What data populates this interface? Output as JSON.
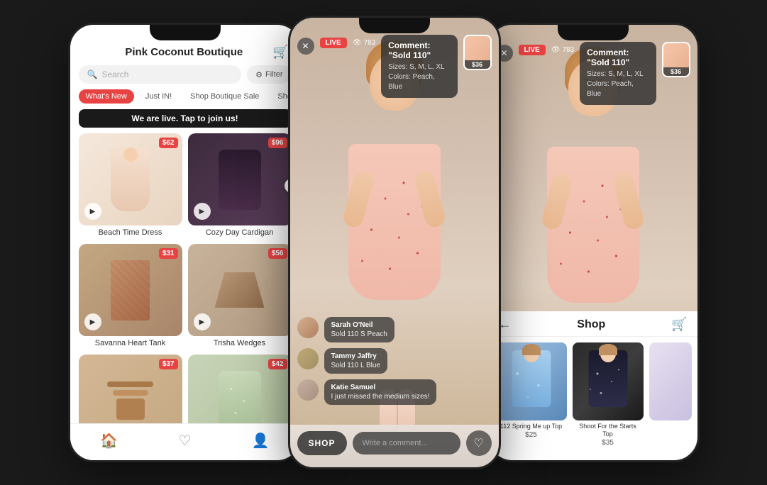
{
  "app1": {
    "title": "Pink Coconut Boutique",
    "search_placeholder": "Search",
    "filter_label": "Filter",
    "tabs": [
      {
        "id": "whats-new",
        "label": "What's New",
        "active": true
      },
      {
        "id": "just-in",
        "label": "Just IN!",
        "active": false
      },
      {
        "id": "shop-boutique-sale",
        "label": "Shop Boutique Sale",
        "active": false
      },
      {
        "id": "shoes",
        "label": "Shoes",
        "active": false
      }
    ],
    "live_banner": "We are live. Tap to join us!",
    "products": [
      {
        "name": "Beach Time Dress",
        "price": "$62",
        "type": "dress"
      },
      {
        "name": "Cozy Day Cardigan",
        "price": "$96",
        "type": "cardigan"
      },
      {
        "name": "Savanna Heart Tank",
        "price": "$31",
        "type": "tank"
      },
      {
        "name": "Trisha Wedges",
        "price": "$56",
        "type": "wedges"
      },
      {
        "name": "",
        "price": "$37",
        "type": "sandals"
      },
      {
        "name": "",
        "price": "$42",
        "type": "floral",
        "live": true
      }
    ],
    "nav": [
      "home",
      "heart",
      "person"
    ]
  },
  "live_stream": {
    "close_label": "✕",
    "live_badge": "LIVE",
    "views": "783",
    "comment_popup": {
      "title": "Comment: \"Sold 110\"",
      "sizes": "Sizes: S, M, L, XL",
      "colors": "Colors: Peach, Blue",
      "price": "$36"
    },
    "messages": [
      {
        "user": "Sarah O'Neil",
        "text": "Sold 110 S Peach"
      },
      {
        "user": "Tammy Jaffry",
        "text": "Sold 110 L Blue"
      },
      {
        "user": "Katie Samuel",
        "text": "I just missed the medium sizes!"
      }
    ],
    "shop_btn": "SHOP",
    "comment_placeholder": "Write a comment..."
  },
  "shop_screen": {
    "close_label": "✕",
    "live_badge": "LIVE",
    "views": "783",
    "comment_popup": {
      "title": "Comment: \"Sold 110\"",
      "sizes": "Sizes: S, M, L, XL",
      "colors": "Colors: Peach, Blue",
      "price": "$36"
    },
    "back_label": "←",
    "title": "Shop",
    "cart_icon": "🛒",
    "products": [
      {
        "name": "112 Spring Me up Top",
        "price": "$25",
        "type": "blue-floral"
      },
      {
        "name": "Shoot For the Starts Top",
        "price": "$35",
        "type": "dark-dots"
      },
      {
        "name": "",
        "price": "",
        "type": "light"
      }
    ]
  }
}
